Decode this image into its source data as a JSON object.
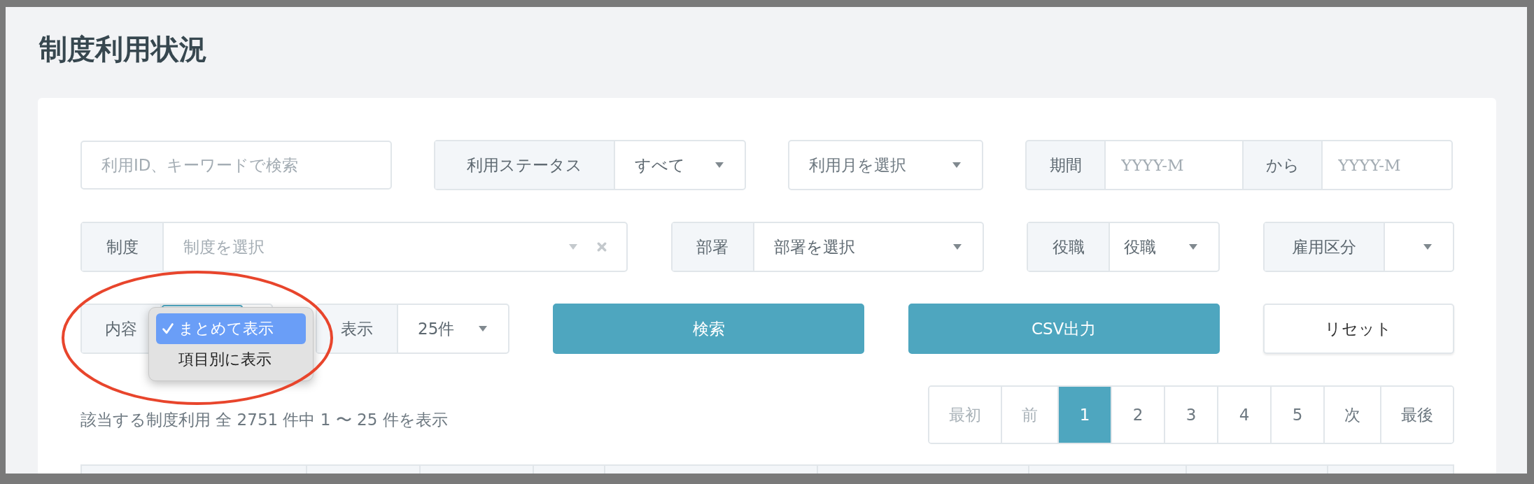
{
  "page_title": "制度利用状況",
  "filters_row1": {
    "search": {
      "placeholder": "利用ID、キーワードで検索"
    },
    "status": {
      "label": "利用ステータス",
      "value": "すべて"
    },
    "month": {
      "placeholder": "利用月を選択"
    },
    "period": {
      "label": "期間",
      "from_placeholder": "YYYY-M",
      "separator": "から",
      "to_placeholder": "YYYY-M"
    }
  },
  "filters_row2": {
    "system": {
      "label": "制度",
      "placeholder": "制度を選択"
    },
    "department": {
      "label": "部署",
      "placeholder": "部署を選択"
    },
    "position": {
      "label": "役職",
      "placeholder": "役職"
    },
    "employment": {
      "label": "雇用区分"
    }
  },
  "content_filter": {
    "label": "内容",
    "options": [
      {
        "label": "まとめて表示",
        "selected": true
      },
      {
        "label": "項目別に表示",
        "selected": false
      }
    ]
  },
  "per_page": {
    "label": "表示",
    "value": "25件"
  },
  "buttons": [
    {
      "label": "検索",
      "kind": "primary"
    },
    {
      "label": "CSV出力",
      "kind": "primary"
    },
    {
      "label": "リセット",
      "kind": "outline"
    }
  ],
  "result_summary": "該当する制度利用 全 2751 件中 1 〜 25 件を表示",
  "pagination": [
    {
      "label": "最初",
      "disabled": true,
      "selected": false
    },
    {
      "label": "前",
      "disabled": true,
      "selected": false
    },
    {
      "label": "1",
      "disabled": false,
      "selected": true
    },
    {
      "label": "2",
      "disabled": false,
      "selected": false
    },
    {
      "label": "3",
      "disabled": false,
      "selected": false
    },
    {
      "label": "4",
      "disabled": false,
      "selected": false
    },
    {
      "label": "5",
      "disabled": false,
      "selected": false
    },
    {
      "label": "次",
      "disabled": false,
      "selected": false
    },
    {
      "label": "最後",
      "disabled": false,
      "selected": false
    }
  ],
  "annotation": {
    "kind": "ellipse",
    "color": "#e8452c"
  }
}
